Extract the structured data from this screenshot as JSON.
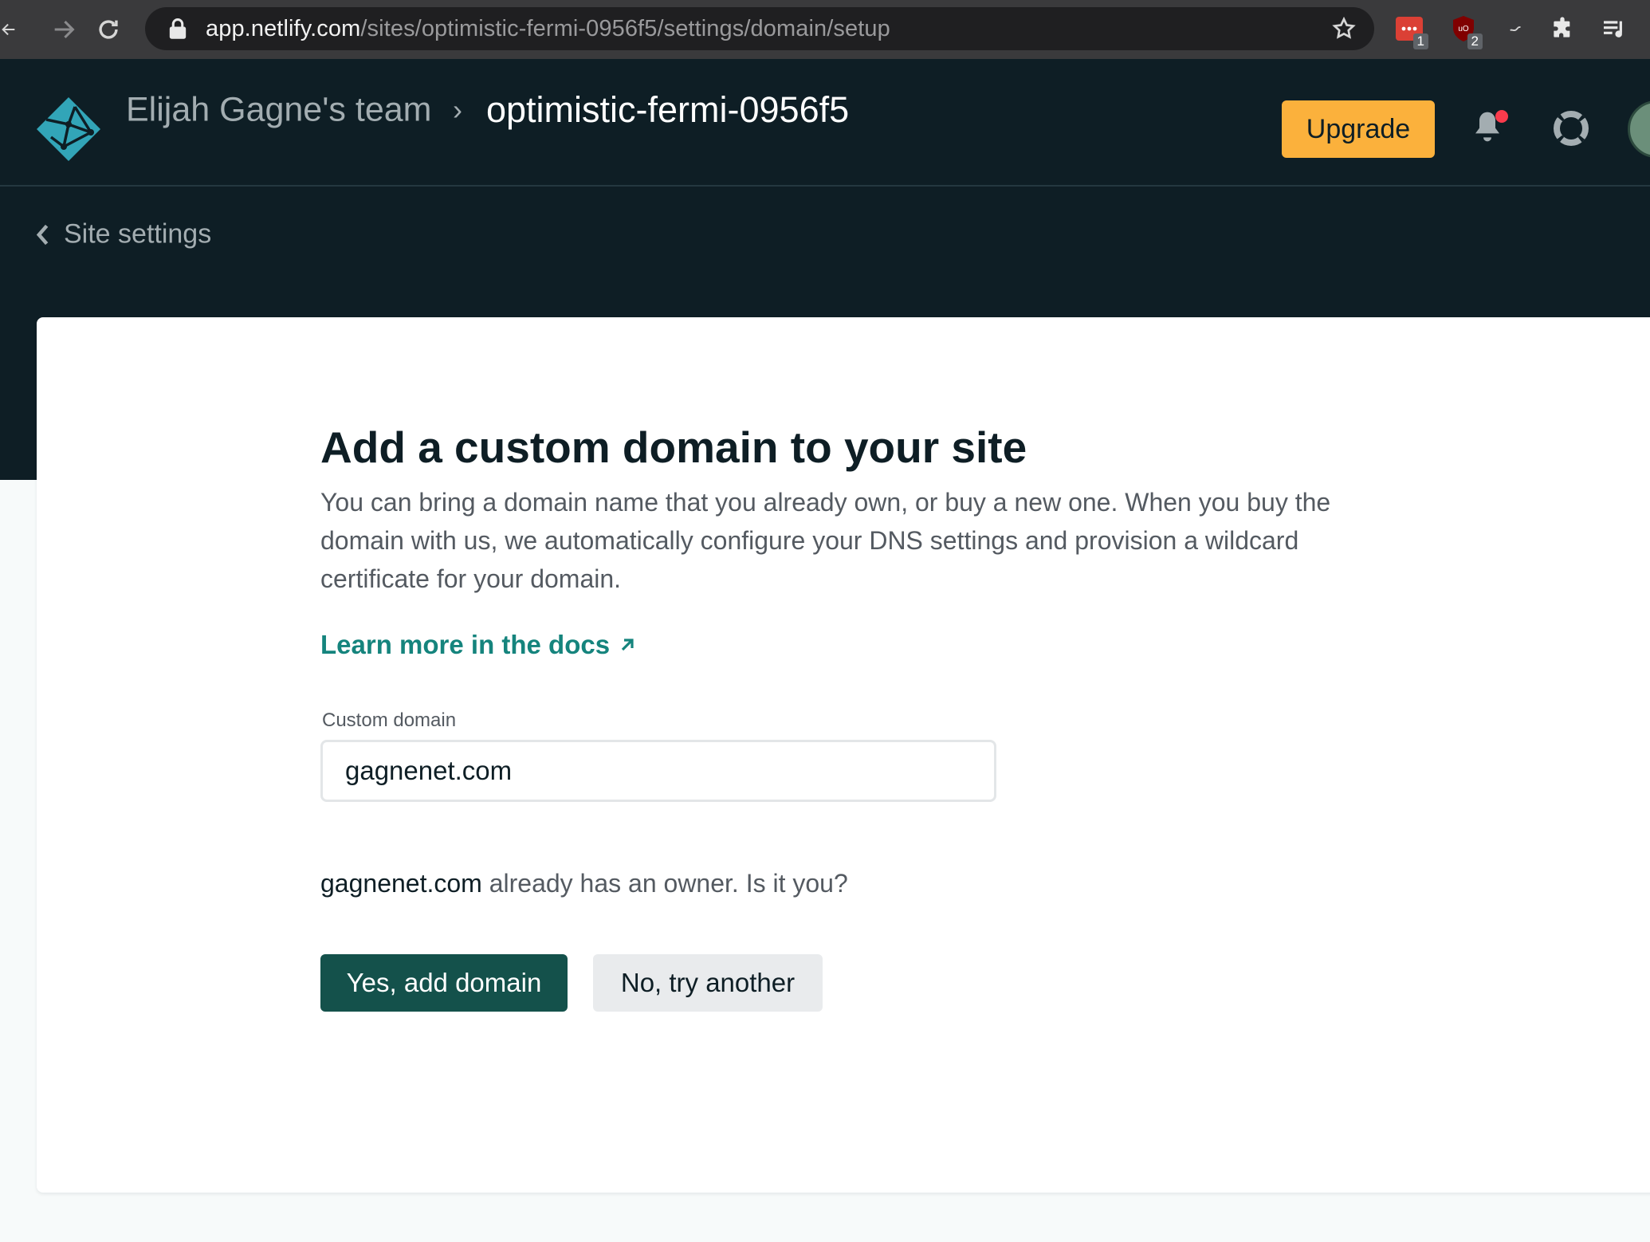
{
  "browser": {
    "url_host": "app.netlify.com",
    "url_path": "/sites/optimistic-fermi-0956f5/settings/domain/setup",
    "extensions": [
      {
        "name": "todoist-extension-icon",
        "badge": "1"
      },
      {
        "name": "ublock-extension-icon",
        "badge": "2"
      },
      {
        "name": "mini-extension-icon",
        "badge": ""
      }
    ]
  },
  "header": {
    "team": "Elijah Gagne's team",
    "separator": "›",
    "site": "optimistic-fermi-0956f5",
    "upgrade_label": "Upgrade"
  },
  "back_link": {
    "label": "Site settings"
  },
  "setup": {
    "title": "Add a custom domain to your site",
    "description": "You can bring a domain name that you already own, or buy a new one. When you buy the domain with us, we automatically configure your DNS settings and provision a wildcard certificate for your domain.",
    "docs_link": "Learn more in the docs",
    "field_label": "Custom domain",
    "field_value": "gagnenet.com",
    "owner_domain": "gagnenet.com",
    "owner_question": " already has an owner. Is it you?",
    "confirm_label": "Yes, add domain",
    "cancel_label": "No, try another"
  },
  "colors": {
    "header_bg": "#0e1e25",
    "upgrade_bg": "#fbb13c",
    "primary_button": "#14514b",
    "link": "#15847d",
    "notification_dot": "#fa3b4c"
  }
}
